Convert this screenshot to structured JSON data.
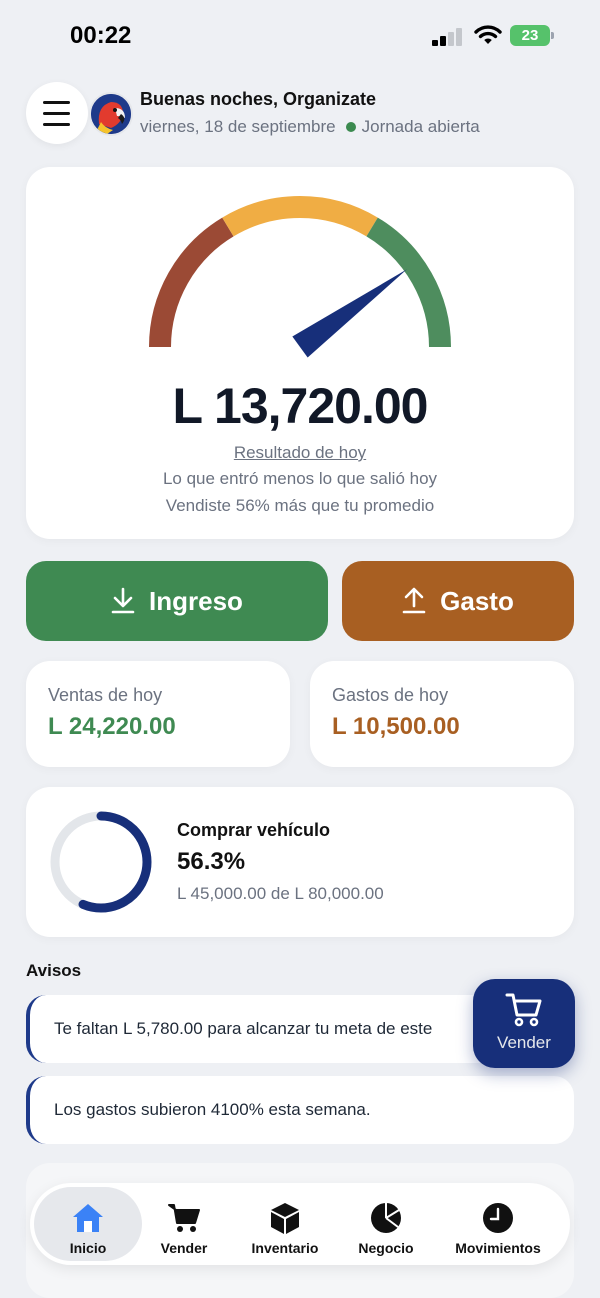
{
  "status_bar": {
    "time": "00:22",
    "battery": "23"
  },
  "header": {
    "greeting": "Buenas noches, Organizate",
    "date": "viernes, 18 de septiembre",
    "status": "Jornada abierta"
  },
  "summary": {
    "amount": "L 13,720.00",
    "result_label": "Resultado de hoy",
    "description": "Lo que entró menos lo que salió hoy",
    "comparison": "Vendiste 56% más que tu promedio",
    "gauge_level": 0.8
  },
  "actions": {
    "income_label": "Ingreso",
    "expense_label": "Gasto"
  },
  "stats": {
    "sales_label": "Ventas de hoy",
    "sales_value": "L 24,220.00",
    "expenses_label": "Gastos de hoy",
    "expenses_value": "L 10,500.00"
  },
  "goal": {
    "title": "Comprar vehículo",
    "percent": "56.3%",
    "progress": 0.563,
    "detail": "L 45,000.00 de L 80,000.00"
  },
  "notices": {
    "title": "Avisos",
    "items": [
      "Te faltan L 5,780.00 para alcanzar tu meta de este",
      "Los gastos subieron 4100% esta semana."
    ]
  },
  "fab": {
    "label": "Vender"
  },
  "tabbar": {
    "items": [
      {
        "label": "Inicio",
        "icon": "home-icon"
      },
      {
        "label": "Vender",
        "icon": "cart-icon"
      },
      {
        "label": "Inventario",
        "icon": "box-icon"
      },
      {
        "label": "Negocio",
        "icon": "pie-chart-icon"
      },
      {
        "label": "Movimientos",
        "icon": "clock-icon"
      }
    ]
  },
  "colors": {
    "income": "#3f8a52",
    "expense": "#a85f22",
    "navy": "#172f7a",
    "gauge_red": "#9b4a35",
    "gauge_yellow": "#f0ad44",
    "gauge_green": "#4e8d5e"
  }
}
